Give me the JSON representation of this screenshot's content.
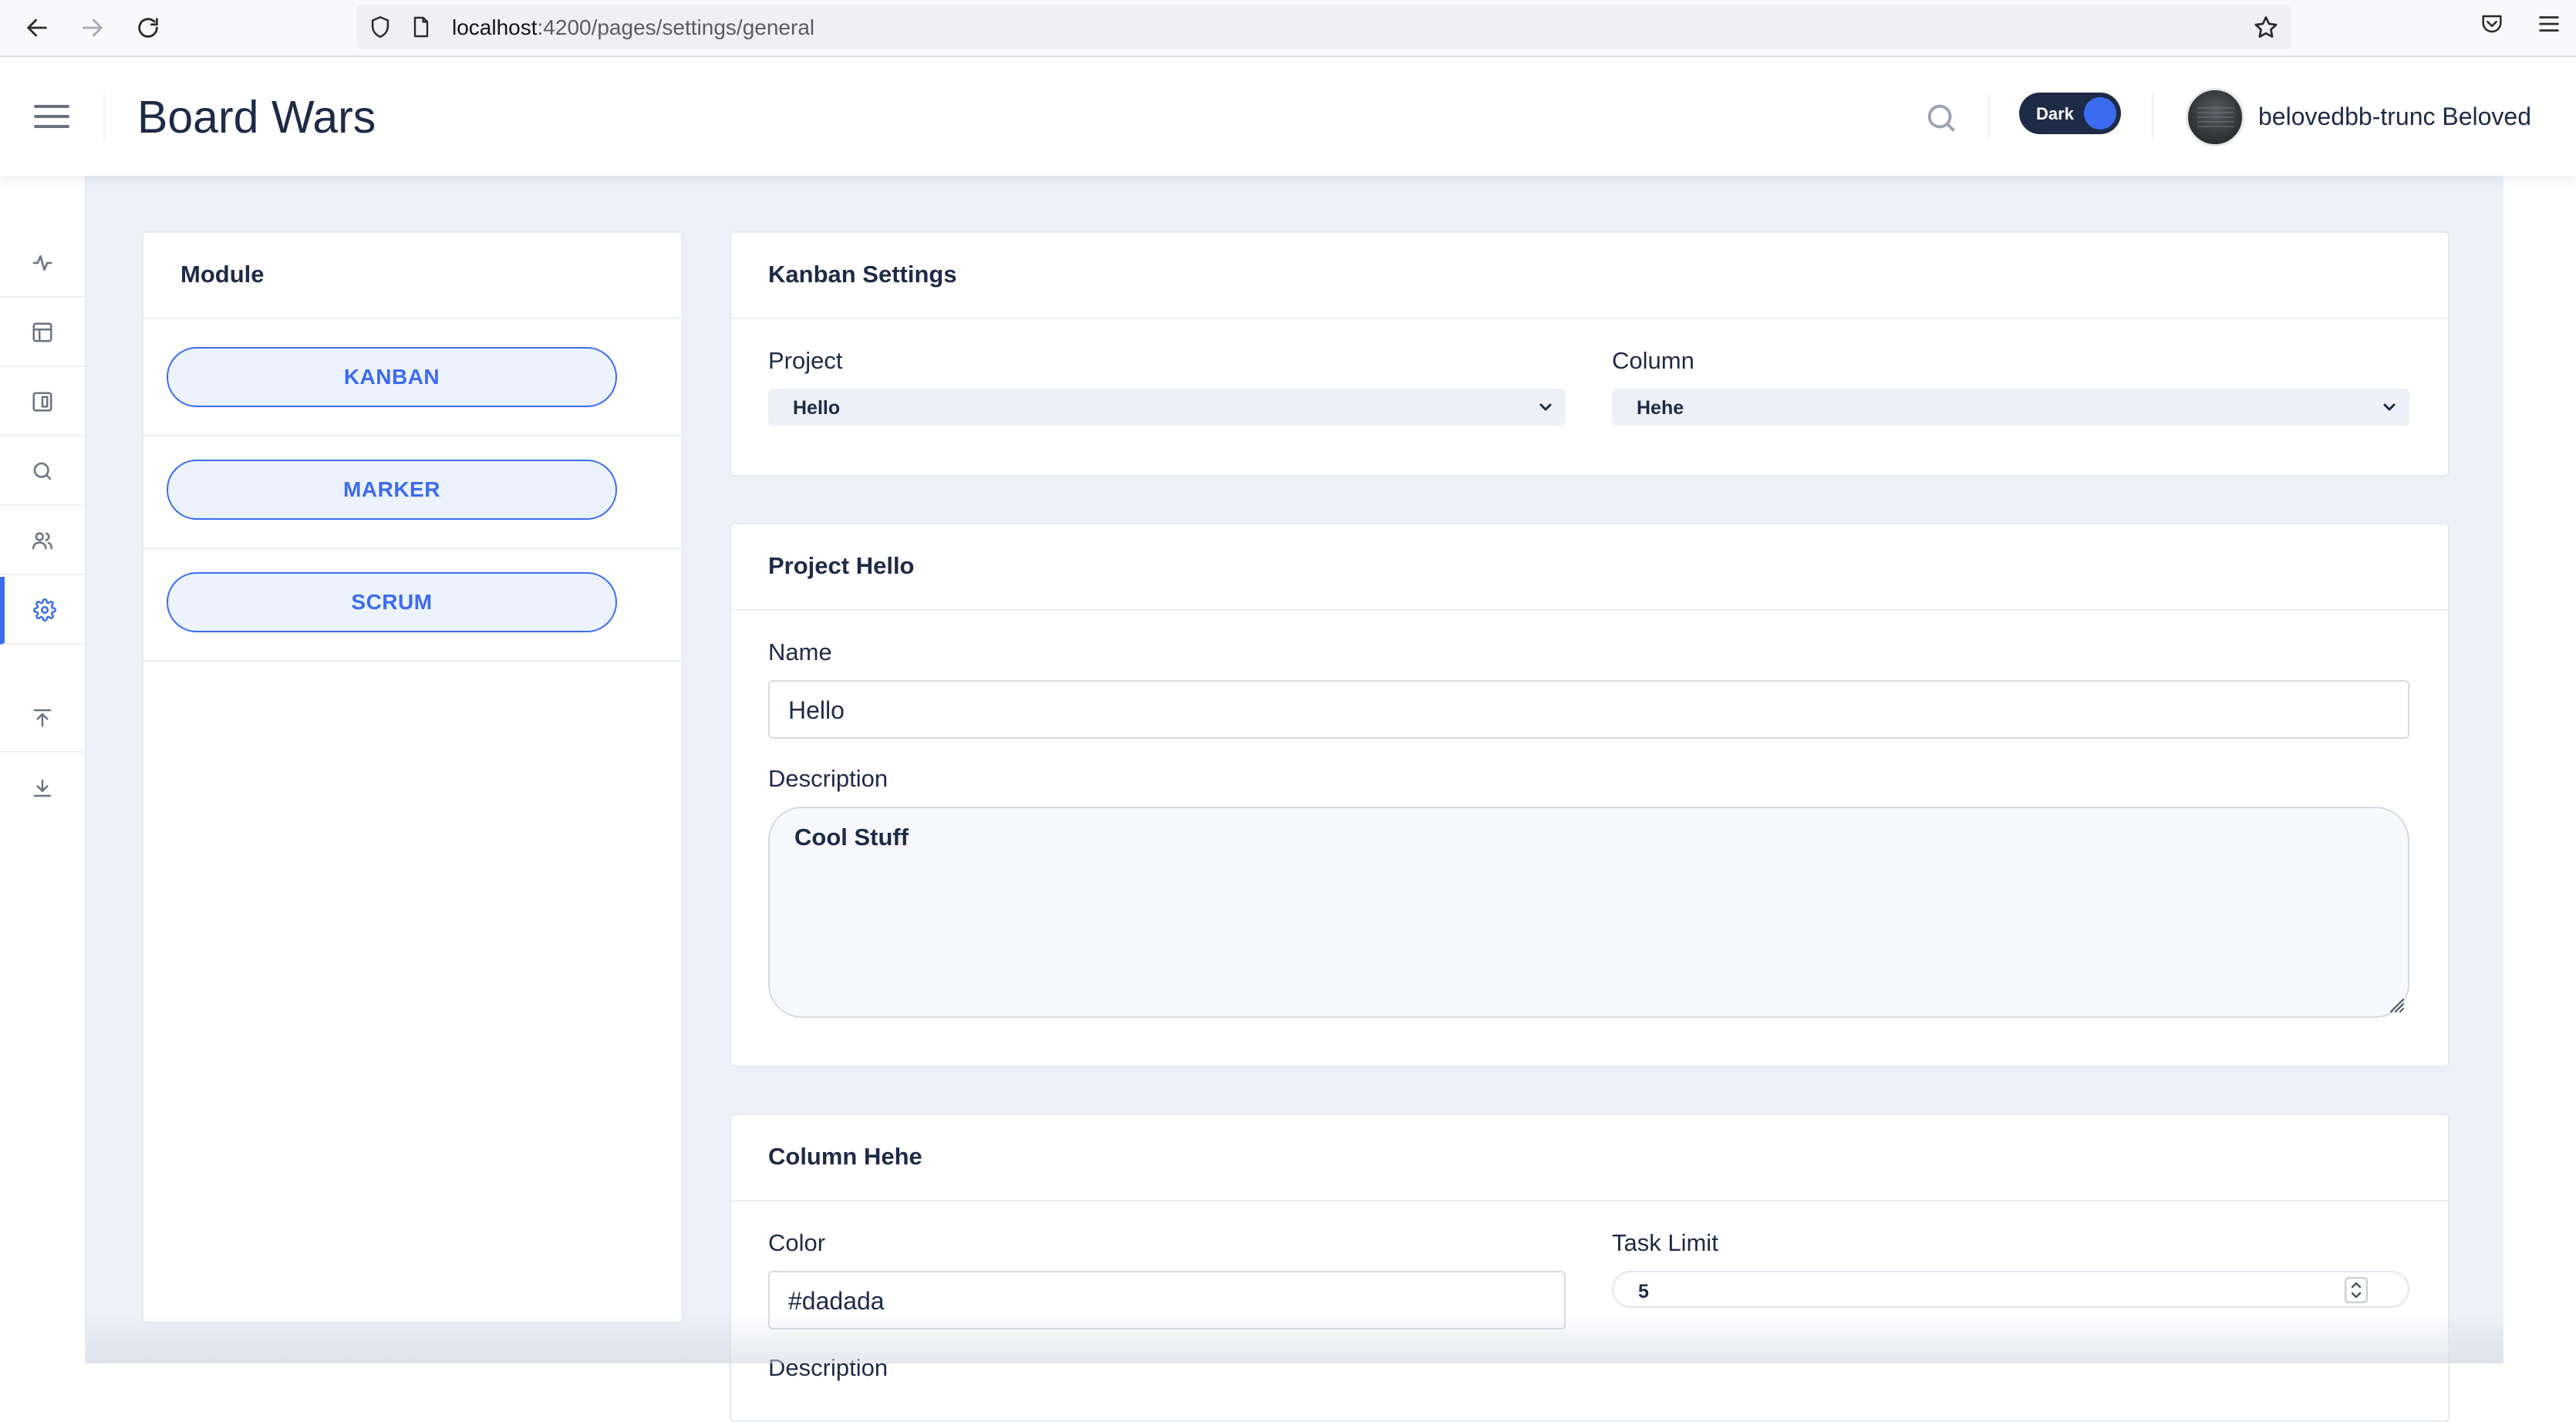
{
  "browser": {
    "url_host": "localhost",
    "url_path": ":4200/pages/settings/general"
  },
  "header": {
    "app_title": "Board Wars",
    "theme_toggle_label": "Dark",
    "user_name": "belovedbb-trunc Beloved"
  },
  "sidebar": {
    "items": [
      {
        "icon": "activity-icon"
      },
      {
        "icon": "layout-icon"
      },
      {
        "icon": "board-icon"
      },
      {
        "icon": "search-icon"
      },
      {
        "icon": "users-icon"
      },
      {
        "icon": "gear-icon",
        "active": true
      },
      {
        "icon": "upload-icon"
      },
      {
        "icon": "download-icon"
      }
    ]
  },
  "module": {
    "title": "Module",
    "buttons": [
      "KANBAN",
      "MARKER",
      "SCRUM"
    ]
  },
  "kanban_settings": {
    "title": "Kanban Settings",
    "project_label": "Project",
    "project_value": "Hello",
    "column_label": "Column",
    "column_value": "Hehe"
  },
  "project_card": {
    "title": "Project Hello",
    "name_label": "Name",
    "name_value": "Hello",
    "description_label": "Description",
    "description_value": "Cool Stuff"
  },
  "column_card": {
    "title": "Column Hehe",
    "color_label": "Color",
    "color_value": "#dadada",
    "task_limit_label": "Task Limit",
    "task_limit_value": "5",
    "next_label_partial": "Description"
  },
  "colors": {
    "accent": "#3b6cf0",
    "navy": "#1e2b47",
    "page_bg": "#eef1f8"
  }
}
